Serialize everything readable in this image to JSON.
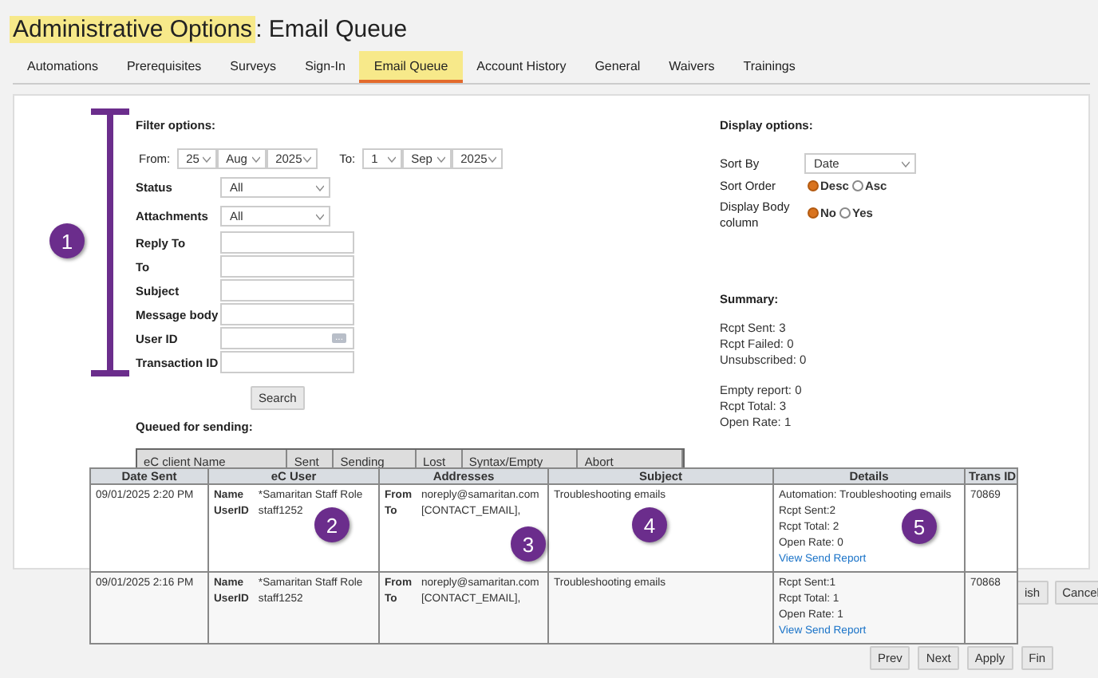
{
  "title": {
    "highlighted": "Administrative Options",
    "rest": ": Email Queue"
  },
  "tabs": [
    {
      "label": "Automations",
      "selected": false
    },
    {
      "label": "Prerequisites",
      "selected": false
    },
    {
      "label": "Surveys",
      "selected": false
    },
    {
      "label": "Sign-In",
      "selected": false
    },
    {
      "label": "Email Queue",
      "selected": true
    },
    {
      "label": "Account History",
      "selected": false
    },
    {
      "label": "General",
      "selected": false
    },
    {
      "label": "Waivers",
      "selected": false
    },
    {
      "label": "Trainings",
      "selected": false
    }
  ],
  "filter": {
    "title": "Filter options:",
    "from": {
      "label": "From:",
      "day": "25",
      "month": "Aug",
      "year": "2025"
    },
    "to": {
      "label": "To:",
      "day": "1",
      "month": "Sep",
      "year": "2025"
    },
    "fields": [
      {
        "label": "Status",
        "kind": "select",
        "value": "All"
      },
      {
        "label": "Attachments",
        "kind": "select",
        "value": "All"
      },
      {
        "label": "Reply To",
        "kind": "text"
      },
      {
        "label": "To",
        "kind": "text"
      },
      {
        "label": "Subject",
        "kind": "text"
      },
      {
        "label": "Message body",
        "kind": "text"
      },
      {
        "label": "User ID",
        "kind": "lookup",
        "button": "..."
      },
      {
        "label": "Transaction ID",
        "kind": "text"
      }
    ],
    "search_button": "Search"
  },
  "display": {
    "title": "Display options:",
    "sort_by": {
      "label": "Sort By",
      "value": "Date"
    },
    "radios": [
      {
        "label": "Sort Order",
        "options": [
          {
            "label": "Desc",
            "selected": true
          },
          {
            "label": "Asc",
            "selected": false
          }
        ]
      },
      {
        "label": "Display Body column",
        "options": [
          {
            "label": "No",
            "selected": true
          },
          {
            "label": "Yes",
            "selected": false
          }
        ]
      }
    ]
  },
  "summary": {
    "title": "Summary:",
    "groups": [
      [
        "Rcpt Sent: 3",
        "Rcpt Failed: 0",
        "Unsubscribed: 0"
      ],
      [
        "Empty report: 0",
        "Rcpt Total: 3",
        "Open Rate: 1"
      ]
    ]
  },
  "queued": {
    "title": "Queued for sending:",
    "columns": [
      "eC client Name",
      "Sent",
      "Sending",
      "Lost",
      "Syntax/Empty",
      "Abort"
    ]
  },
  "side_buttons": [
    "ish",
    "Cancel"
  ],
  "email_table": {
    "columns": [
      "Date Sent",
      "eC User",
      "Addresses",
      "Subject",
      "Details",
      "Trans ID"
    ],
    "rows": [
      {
        "date": "09/01/2025 2:20 PM",
        "user": [
          [
            "Name",
            "*Samaritan Staff Role"
          ],
          [
            "UserID",
            "staff1252"
          ]
        ],
        "addresses": [
          [
            "From",
            "noreply@samaritan.com"
          ],
          [
            "To",
            "[CONTACT_EMAIL],"
          ]
        ],
        "subject": "Troubleshooting emails",
        "details": [
          "Automation: Troubleshooting emails",
          "Rcpt Sent:2",
          "Rcpt Total: 2",
          "Open Rate: 0"
        ],
        "link": "View Send Report",
        "trans_id": "70869"
      },
      {
        "date": "09/01/2025 2:16 PM",
        "user": [
          [
            "Name",
            "*Samaritan Staff Role"
          ],
          [
            "UserID",
            "staff1252"
          ]
        ],
        "addresses": [
          [
            "From",
            "noreply@samaritan.com"
          ],
          [
            "To",
            "[CONTACT_EMAIL],"
          ]
        ],
        "subject": "Troubleshooting emails",
        "details": [
          "Rcpt Sent:1",
          "Rcpt Total: 1",
          "Open Rate: 1"
        ],
        "link": "View Send Report",
        "trans_id": "70868"
      }
    ]
  },
  "pager": [
    "Prev",
    "Next",
    "Apply",
    "Fin"
  ],
  "callouts": [
    "1",
    "2",
    "3",
    "4",
    "5"
  ]
}
